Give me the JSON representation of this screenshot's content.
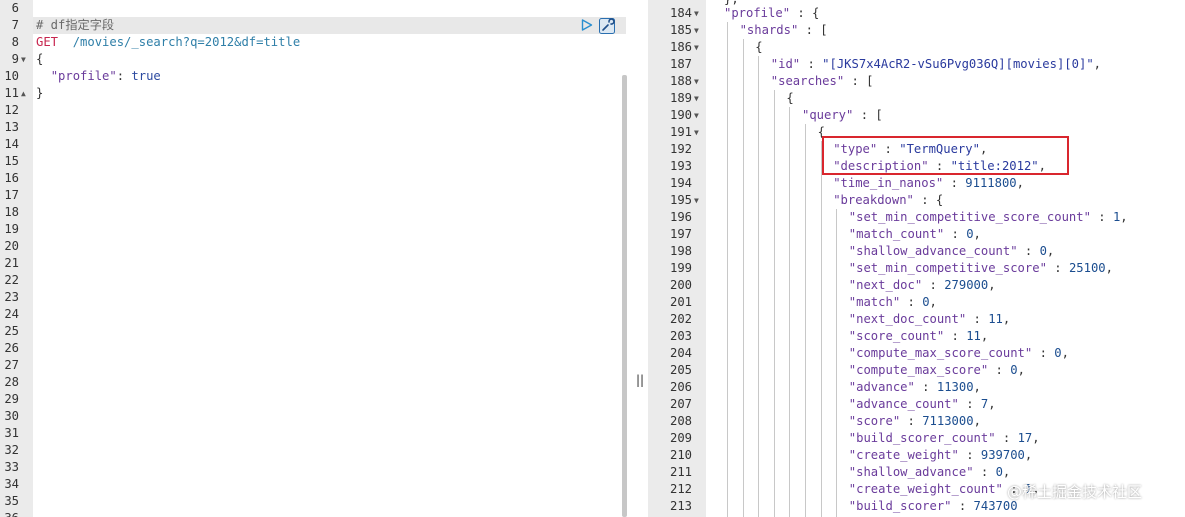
{
  "left_editor": {
    "lines": [
      {
        "n": "6",
        "text": ""
      },
      {
        "n": "7",
        "text": "# df指定字段",
        "fold": "",
        "kind": "comment"
      },
      {
        "n": "8",
        "verb": "GET",
        "path": "  /movies/_search?q=2012&df=title"
      },
      {
        "n": "9",
        "text": "{",
        "fold": "▼"
      },
      {
        "n": "10",
        "key": "\"profile\"",
        "sep": ": ",
        "val": "true"
      },
      {
        "n": "11",
        "text": "}",
        "fold": "▲"
      },
      {
        "n": "12"
      },
      {
        "n": "13"
      },
      {
        "n": "14"
      },
      {
        "n": "15"
      },
      {
        "n": "16"
      },
      {
        "n": "17"
      },
      {
        "n": "18"
      },
      {
        "n": "19"
      },
      {
        "n": "20"
      },
      {
        "n": "21"
      },
      {
        "n": "22"
      },
      {
        "n": "23"
      },
      {
        "n": "24"
      },
      {
        "n": "25"
      },
      {
        "n": "26"
      },
      {
        "n": "27"
      },
      {
        "n": "28"
      },
      {
        "n": "29"
      },
      {
        "n": "30"
      },
      {
        "n": "31"
      },
      {
        "n": "32"
      },
      {
        "n": "33"
      },
      {
        "n": "34"
      },
      {
        "n": "35"
      },
      {
        "n": "36"
      }
    ]
  },
  "right_editor": {
    "top_partial": "},",
    "lines": [
      {
        "n": "184",
        "fold": "▼",
        "indent": 0,
        "parts": [
          [
            "key",
            "\"profile\""
          ],
          [
            "punc",
            " : {"
          ]
        ]
      },
      {
        "n": "185",
        "fold": "▼",
        "indent": 1,
        "parts": [
          [
            "key",
            "\"shards\""
          ],
          [
            "punc",
            " : ["
          ]
        ]
      },
      {
        "n": "186",
        "fold": "▼",
        "indent": 2,
        "parts": [
          [
            "punc",
            "{"
          ]
        ]
      },
      {
        "n": "187",
        "indent": 3,
        "parts": [
          [
            "key",
            "\"id\""
          ],
          [
            "punc",
            " : "
          ],
          [
            "str",
            "\"[JKS7x4AcR2-vSu6Pvg036Q][movies][0]\""
          ],
          [
            "punc",
            ","
          ]
        ]
      },
      {
        "n": "188",
        "fold": "▼",
        "indent": 3,
        "parts": [
          [
            "key",
            "\"searches\""
          ],
          [
            "punc",
            " : ["
          ]
        ]
      },
      {
        "n": "189",
        "fold": "▼",
        "indent": 4,
        "parts": [
          [
            "punc",
            "{"
          ]
        ]
      },
      {
        "n": "190",
        "fold": "▼",
        "indent": 5,
        "parts": [
          [
            "key",
            "\"query\""
          ],
          [
            "punc",
            " : ["
          ]
        ]
      },
      {
        "n": "191",
        "fold": "▼",
        "indent": 6,
        "parts": [
          [
            "punc",
            "{"
          ]
        ]
      },
      {
        "n": "192",
        "indent": 7,
        "parts": [
          [
            "key",
            "\"type\""
          ],
          [
            "punc",
            " : "
          ],
          [
            "str",
            "\"TermQuery\""
          ],
          [
            "punc",
            ","
          ]
        ]
      },
      {
        "n": "193",
        "indent": 7,
        "parts": [
          [
            "key",
            "\"description\""
          ],
          [
            "punc",
            " : "
          ],
          [
            "str",
            "\"title:2012\""
          ],
          [
            "punc",
            ","
          ]
        ]
      },
      {
        "n": "194",
        "indent": 7,
        "parts": [
          [
            "key",
            "\"time_in_nanos\""
          ],
          [
            "punc",
            " : "
          ],
          [
            "num",
            "9111800"
          ],
          [
            "punc",
            ","
          ]
        ]
      },
      {
        "n": "195",
        "fold": "▼",
        "indent": 7,
        "parts": [
          [
            "key",
            "\"breakdown\""
          ],
          [
            "punc",
            " : {"
          ]
        ]
      },
      {
        "n": "196",
        "indent": 8,
        "parts": [
          [
            "key",
            "\"set_min_competitive_score_count\""
          ],
          [
            "punc",
            " : "
          ],
          [
            "num",
            "1"
          ],
          [
            "punc",
            ","
          ]
        ]
      },
      {
        "n": "197",
        "indent": 8,
        "parts": [
          [
            "key",
            "\"match_count\""
          ],
          [
            "punc",
            " : "
          ],
          [
            "num",
            "0"
          ],
          [
            "punc",
            ","
          ]
        ]
      },
      {
        "n": "198",
        "indent": 8,
        "parts": [
          [
            "key",
            "\"shallow_advance_count\""
          ],
          [
            "punc",
            " : "
          ],
          [
            "num",
            "0"
          ],
          [
            "punc",
            ","
          ]
        ]
      },
      {
        "n": "199",
        "indent": 8,
        "parts": [
          [
            "key",
            "\"set_min_competitive_score\""
          ],
          [
            "punc",
            " : "
          ],
          [
            "num",
            "25100"
          ],
          [
            "punc",
            ","
          ]
        ]
      },
      {
        "n": "200",
        "indent": 8,
        "parts": [
          [
            "key",
            "\"next_doc\""
          ],
          [
            "punc",
            " : "
          ],
          [
            "num",
            "279000"
          ],
          [
            "punc",
            ","
          ]
        ]
      },
      {
        "n": "201",
        "indent": 8,
        "parts": [
          [
            "key",
            "\"match\""
          ],
          [
            "punc",
            " : "
          ],
          [
            "num",
            "0"
          ],
          [
            "punc",
            ","
          ]
        ]
      },
      {
        "n": "202",
        "indent": 8,
        "parts": [
          [
            "key",
            "\"next_doc_count\""
          ],
          [
            "punc",
            " : "
          ],
          [
            "num",
            "11"
          ],
          [
            "punc",
            ","
          ]
        ]
      },
      {
        "n": "203",
        "indent": 8,
        "parts": [
          [
            "key",
            "\"score_count\""
          ],
          [
            "punc",
            " : "
          ],
          [
            "num",
            "11"
          ],
          [
            "punc",
            ","
          ]
        ]
      },
      {
        "n": "204",
        "indent": 8,
        "parts": [
          [
            "key",
            "\"compute_max_score_count\""
          ],
          [
            "punc",
            " : "
          ],
          [
            "num",
            "0"
          ],
          [
            "punc",
            ","
          ]
        ]
      },
      {
        "n": "205",
        "indent": 8,
        "parts": [
          [
            "key",
            "\"compute_max_score\""
          ],
          [
            "punc",
            " : "
          ],
          [
            "num",
            "0"
          ],
          [
            "punc",
            ","
          ]
        ]
      },
      {
        "n": "206",
        "indent": 8,
        "parts": [
          [
            "key",
            "\"advance\""
          ],
          [
            "punc",
            " : "
          ],
          [
            "num",
            "11300"
          ],
          [
            "punc",
            ","
          ]
        ]
      },
      {
        "n": "207",
        "indent": 8,
        "parts": [
          [
            "key",
            "\"advance_count\""
          ],
          [
            "punc",
            " : "
          ],
          [
            "num",
            "7"
          ],
          [
            "punc",
            ","
          ]
        ]
      },
      {
        "n": "208",
        "indent": 8,
        "parts": [
          [
            "key",
            "\"score\""
          ],
          [
            "punc",
            " : "
          ],
          [
            "num",
            "7113000"
          ],
          [
            "punc",
            ","
          ]
        ]
      },
      {
        "n": "209",
        "indent": 8,
        "parts": [
          [
            "key",
            "\"build_scorer_count\""
          ],
          [
            "punc",
            " : "
          ],
          [
            "num",
            "17"
          ],
          [
            "punc",
            ","
          ]
        ]
      },
      {
        "n": "210",
        "indent": 8,
        "parts": [
          [
            "key",
            "\"create_weight\""
          ],
          [
            "punc",
            " : "
          ],
          [
            "num",
            "939700"
          ],
          [
            "punc",
            ","
          ]
        ]
      },
      {
        "n": "211",
        "indent": 8,
        "parts": [
          [
            "key",
            "\"shallow_advance\""
          ],
          [
            "punc",
            " : "
          ],
          [
            "num",
            "0"
          ],
          [
            "punc",
            ","
          ]
        ]
      },
      {
        "n": "212",
        "indent": 8,
        "parts": [
          [
            "key",
            "\"create_weight_count\""
          ],
          [
            "punc",
            " : "
          ],
          [
            "num",
            "1"
          ],
          [
            "punc",
            ","
          ]
        ]
      },
      {
        "n": "213",
        "indent": 8,
        "parts": [
          [
            "key",
            "\"build_scorer\""
          ],
          [
            "punc",
            " : "
          ],
          [
            "num",
            "743700"
          ]
        ]
      }
    ]
  },
  "toolbar": {
    "run_icon": "play-icon",
    "settings_icon": "wrench-icon"
  },
  "divider": {
    "handle": "||"
  },
  "watermark": "@稀土掘金技术社区",
  "colors": {
    "highlight_box": "#d9262e",
    "gutter": "#ebebeb",
    "verb": "#c7254e",
    "key": "#6a3b9b",
    "string": "#2a3a9e"
  }
}
